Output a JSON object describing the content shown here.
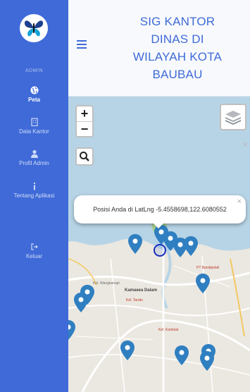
{
  "sidebar": {
    "section_label": "ADMIN",
    "items": [
      {
        "label": "Peta",
        "icon": "globe-icon",
        "active": true
      },
      {
        "label": "Data Kantor",
        "icon": "building-icon"
      },
      {
        "label": "Profil Admin",
        "icon": "user-icon"
      },
      {
        "label": "Tentang Aplikasi",
        "icon": "info-icon"
      },
      {
        "label": "Keluar",
        "icon": "sign-out-icon"
      }
    ]
  },
  "header": {
    "title_lines": [
      "SIG KANTOR",
      "DINAS DI",
      "WILAYAH KOTA",
      "BAUBAU"
    ]
  },
  "map": {
    "zoom_in": "+",
    "zoom_out": "−",
    "popup_text": "Posisi Anda di LatLng -5.4558698,122.6080552",
    "popup_close": "×",
    "panel_close": "×",
    "labels": [
      "Kamaeea Dalam",
      "PT Bandipelali",
      "Kel. Wangkanapi",
      "Kel. Tarafu",
      "Kel. Kaobula"
    ]
  },
  "colors": {
    "brand": "#3f6ad8",
    "marker": "#2f7fc1",
    "map_bg": "#ebe8e1",
    "sea": "#b7d4e6"
  }
}
